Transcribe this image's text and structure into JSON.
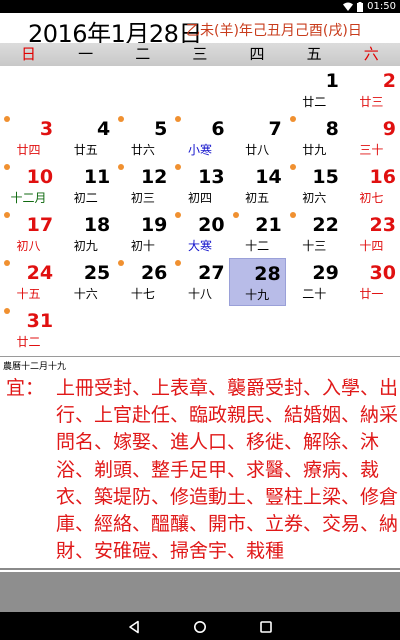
{
  "status": {
    "time": "01:50"
  },
  "header": {
    "gregorian": "2016年1月28日",
    "lunar": "乙未(羊)年己丑月己酉(戌)日"
  },
  "weekdays": [
    "日",
    "一",
    "二",
    "三",
    "四",
    "五",
    "六"
  ],
  "calendar": {
    "selected_day": "28",
    "cells": [
      {
        "day": "1",
        "lunar": "廿二",
        "weekday": 5
      },
      {
        "day": "2",
        "lunar": "廿三",
        "weekday": 6
      },
      {
        "day": "3",
        "lunar": "廿四",
        "weekday": 0
      },
      {
        "day": "4",
        "lunar": "廿五",
        "weekday": 1
      },
      {
        "day": "5",
        "lunar": "廿六",
        "weekday": 2
      },
      {
        "day": "6",
        "lunar": "小寒",
        "weekday": 3
      },
      {
        "day": "7",
        "lunar": "廿八",
        "weekday": 4
      },
      {
        "day": "8",
        "lunar": "廿九",
        "weekday": 5
      },
      {
        "day": "9",
        "lunar": "三十",
        "weekday": 6
      },
      {
        "day": "10",
        "lunar": "十二月",
        "weekday": 0
      },
      {
        "day": "11",
        "lunar": "初二",
        "weekday": 1
      },
      {
        "day": "12",
        "lunar": "初三",
        "weekday": 2
      },
      {
        "day": "13",
        "lunar": "初四",
        "weekday": 3
      },
      {
        "day": "14",
        "lunar": "初五",
        "weekday": 4
      },
      {
        "day": "15",
        "lunar": "初六",
        "weekday": 5
      },
      {
        "day": "16",
        "lunar": "初七",
        "weekday": 6
      },
      {
        "day": "17",
        "lunar": "初八",
        "weekday": 0
      },
      {
        "day": "18",
        "lunar": "初九",
        "weekday": 1
      },
      {
        "day": "19",
        "lunar": "初十",
        "weekday": 2
      },
      {
        "day": "20",
        "lunar": "大寒",
        "weekday": 3
      },
      {
        "day": "21",
        "lunar": "十二",
        "weekday": 4
      },
      {
        "day": "22",
        "lunar": "十三",
        "weekday": 5
      },
      {
        "day": "23",
        "lunar": "十四",
        "weekday": 6
      },
      {
        "day": "24",
        "lunar": "十五",
        "weekday": 0
      },
      {
        "day": "25",
        "lunar": "十六",
        "weekday": 1
      },
      {
        "day": "26",
        "lunar": "十七",
        "weekday": 2
      },
      {
        "day": "27",
        "lunar": "十八",
        "weekday": 3
      },
      {
        "day": "28",
        "lunar": "十九",
        "weekday": 4
      },
      {
        "day": "29",
        "lunar": "二十",
        "weekday": 5
      },
      {
        "day": "30",
        "lunar": "廿一",
        "weekday": 6
      },
      {
        "day": "31",
        "lunar": "廿二",
        "weekday": 0
      }
    ],
    "dot_days": [
      "3",
      "5",
      "6",
      "8",
      "10",
      "12",
      "13",
      "15",
      "17",
      "20",
      "21",
      "22",
      "24",
      "26",
      "27",
      "31"
    ]
  },
  "panel": {
    "lunar_label": "農曆十二月十九",
    "yi_key": "宜：",
    "yi_text": "上冊受封、上表章、襲爵受封、入學、出行、上官赴任、臨政親民、結婚姻、納采問名、嫁娶、進人口、移徙、解除、沐浴、剃頭、整手足甲、求醫、療病、裁衣、築堤防、修造動土、豎柱上梁、修倉庫、經絡、醞釀、開市、立券、交易、納財、安碓磑、掃舍宇、栽種"
  },
  "colors": {
    "weekend": "#e01010",
    "lunar_month_start": "#106a10",
    "solar_term": "#1515cc",
    "festival_dot": "#f09030",
    "selected_bg": "#b8bce8",
    "lunar_header": "#c83c1c"
  }
}
